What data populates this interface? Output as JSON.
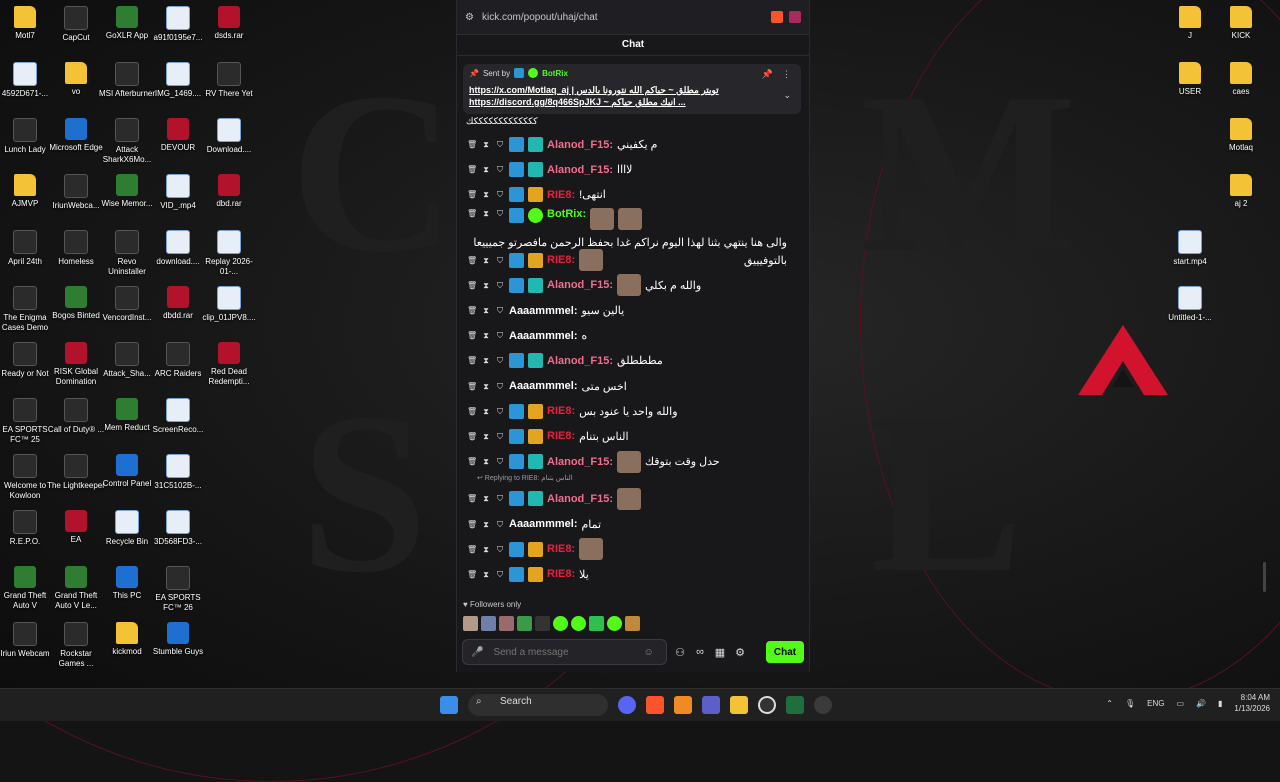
{
  "desktop": {
    "left_icons": [
      {
        "label": "Motl7",
        "kind": "folder"
      },
      {
        "label": "CapCut",
        "kind": "app"
      },
      {
        "label": "GoXLR App",
        "kind": "green"
      },
      {
        "label": "a91f0195e7...",
        "kind": "file"
      },
      {
        "label": "dsds.rar",
        "kind": "red"
      },
      {
        "label": "4592D671-...",
        "kind": "file"
      },
      {
        "label": "vo",
        "kind": "folder"
      },
      {
        "label": "MSI Afterburner",
        "kind": "app"
      },
      {
        "label": "IMG_1469....",
        "kind": "file"
      },
      {
        "label": "RV There Yet",
        "kind": "app"
      },
      {
        "label": "Lunch Lady",
        "kind": "app"
      },
      {
        "label": "Microsoft Edge",
        "kind": "blue"
      },
      {
        "label": "Attack SharkX6Mo...",
        "kind": "app"
      },
      {
        "label": "DEVOUR",
        "kind": "red"
      },
      {
        "label": "Download....",
        "kind": "file"
      },
      {
        "label": "AJMVP",
        "kind": "folder"
      },
      {
        "label": "IriunWebca...",
        "kind": "app"
      },
      {
        "label": "Wise Memor...",
        "kind": "green"
      },
      {
        "label": "VID_.mp4",
        "kind": "file"
      },
      {
        "label": "dbd.rar",
        "kind": "red"
      },
      {
        "label": "April 24th",
        "kind": "app"
      },
      {
        "label": "Homeless",
        "kind": "app"
      },
      {
        "label": "Revo Uninstaller",
        "kind": "app"
      },
      {
        "label": "download....",
        "kind": "file"
      },
      {
        "label": "Replay 2026-01-...",
        "kind": "file"
      },
      {
        "label": "The Enigma Cases Demo",
        "kind": "app"
      },
      {
        "label": "Bogos Binted",
        "kind": "green"
      },
      {
        "label": "VencordInst...",
        "kind": "app"
      },
      {
        "label": "dbdd.rar",
        "kind": "red"
      },
      {
        "label": "clip_01JPV8....",
        "kind": "file"
      },
      {
        "label": "Ready or Not",
        "kind": "app"
      },
      {
        "label": "RISK Global Domination",
        "kind": "red"
      },
      {
        "label": "Attack_Sha...",
        "kind": "app"
      },
      {
        "label": "ARC Raiders",
        "kind": "app"
      },
      {
        "label": "Red Dead Redempti...",
        "kind": "red"
      },
      {
        "label": "EA SPORTS FC™ 25",
        "kind": "app"
      },
      {
        "label": "Call of Duty® ...",
        "kind": "app"
      },
      {
        "label": "Mem Reduct",
        "kind": "green"
      },
      {
        "label": "ScreenReco...",
        "kind": "file"
      },
      {
        "label": "",
        "kind": "none"
      },
      {
        "label": "Welcome to Kowloon",
        "kind": "app"
      },
      {
        "label": "The Lightkeeper",
        "kind": "app"
      },
      {
        "label": "Control Panel",
        "kind": "blue"
      },
      {
        "label": "31C5102B-...",
        "kind": "file"
      },
      {
        "label": "",
        "kind": "none"
      },
      {
        "label": "R.E.P.O.",
        "kind": "app"
      },
      {
        "label": "EA",
        "kind": "red"
      },
      {
        "label": "Recycle Bin",
        "kind": "file"
      },
      {
        "label": "3D568FD3-...",
        "kind": "file"
      },
      {
        "label": "",
        "kind": "none"
      },
      {
        "label": "Grand Theft Auto V",
        "kind": "green"
      },
      {
        "label": "Grand Theft Auto V Le...",
        "kind": "green"
      },
      {
        "label": "This PC",
        "kind": "blue"
      },
      {
        "label": "EA SPORTS FC™ 26",
        "kind": "app"
      },
      {
        "label": "",
        "kind": "none"
      },
      {
        "label": "Iriun Webcam",
        "kind": "app"
      },
      {
        "label": "Rockstar Games ...",
        "kind": "app"
      },
      {
        "label": "kickmod",
        "kind": "folder"
      },
      {
        "label": "Stumble Guys",
        "kind": "blue"
      },
      {
        "label": "",
        "kind": "none"
      }
    ],
    "right_icons": [
      {
        "label": "J",
        "kind": "folder"
      },
      {
        "label": "KICK",
        "kind": "folder"
      },
      {
        "label": "USER",
        "kind": "folder"
      },
      {
        "label": "caes",
        "kind": "folder"
      },
      {
        "label": "",
        "kind": "none"
      },
      {
        "label": "Motlaq",
        "kind": "folder"
      },
      {
        "label": "",
        "kind": "none"
      },
      {
        "label": "aj 2",
        "kind": "folder"
      },
      {
        "label": "start.mp4",
        "kind": "file"
      },
      {
        "label": "",
        "kind": "none"
      },
      {
        "label": "Untitled-1-...",
        "kind": "file"
      },
      {
        "label": "",
        "kind": "none"
      }
    ]
  },
  "browser": {
    "url": "kick.com/popout/uhaj/chat",
    "chat_title": "Chat"
  },
  "pinned": {
    "sent_by_label": "Sent by",
    "bot_name": "BotRix",
    "line1": "https://x.com/Motlaq_aj | تويتر مطلق ~ حياكم الله نتورونا بالدس",
    "line2": "https://discord.gg/8q466SpJKJ ~ انيك مطلق حياكم ..."
  },
  "fragment_text": "كككككككككككككك",
  "messages": [
    {
      "user": "Alanod_F15",
      "color": "#f26d8e",
      "badges": [
        "blue",
        "teal"
      ],
      "text": "م يكفيني",
      "emotes": 0
    },
    {
      "user": "Alanod_F15",
      "color": "#f26d8e",
      "badges": [
        "blue",
        "teal"
      ],
      "text": "لاااا",
      "emotes": 0
    },
    {
      "user": "RIE8",
      "color": "#e8213f",
      "badges": [
        "blue",
        "crown"
      ],
      "text": "انتهى!",
      "emotes": 0
    },
    {
      "user": "BotRix",
      "color": "#53fc18",
      "badges": [
        "blue",
        "check"
      ],
      "text": "والى هنا ينتهي بثنا لهذا اليوم نراكم غدا بحفظ الرحمن مافصرتو جميييعا بالتوفيييق",
      "emotes": 2,
      "tall": true
    },
    {
      "user": "RIE8",
      "color": "#e8213f",
      "badges": [
        "blue",
        "crown"
      ],
      "text": "",
      "emotes": 1
    },
    {
      "user": "Alanod_F15",
      "color": "#f26d8e",
      "badges": [
        "blue",
        "teal"
      ],
      "text": "والله م بكلي",
      "emotes": 1
    },
    {
      "user": "Aaaammmel",
      "color": "#ffffff",
      "badges": [],
      "text": "يالين سيو",
      "emotes": 0
    },
    {
      "user": "Aaaammmel",
      "color": "#ffffff",
      "badges": [],
      "text": "ه",
      "emotes": 0
    },
    {
      "user": "Alanod_F15",
      "color": "#f26d8e",
      "badges": [
        "blue",
        "teal"
      ],
      "text": "مطططلق",
      "emotes": 0
    },
    {
      "user": "Aaaammmel",
      "color": "#ffffff",
      "badges": [],
      "text": "اخس متى",
      "emotes": 0
    },
    {
      "user": "RIE8",
      "color": "#e8213f",
      "badges": [
        "blue",
        "crown"
      ],
      "text": "والله واحد يا عنود بس",
      "emotes": 0
    },
    {
      "user": "RIE8",
      "color": "#e8213f",
      "badges": [
        "blue",
        "crown"
      ],
      "text": "الناس بتنام",
      "emotes": 0
    },
    {
      "user": "Alanod_F15",
      "color": "#f26d8e",
      "badges": [
        "blue",
        "teal"
      ],
      "text": "حدل وقت بتوقك",
      "emotes": 1
    },
    {
      "reply": "Replying to RIE8: الناس بتنام"
    },
    {
      "user": "Alanod_F15",
      "color": "#f26d8e",
      "badges": [
        "blue",
        "teal"
      ],
      "text": "",
      "emotes": 1
    },
    {
      "user": "Aaaammmel",
      "color": "#ffffff",
      "badges": [],
      "text": "تمام",
      "emotes": 0
    },
    {
      "user": "RIE8",
      "color": "#e8213f",
      "badges": [
        "blue",
        "crown"
      ],
      "text": "",
      "emotes": 1
    },
    {
      "user": "RIE8",
      "color": "#e8213f",
      "badges": [
        "blue",
        "crown"
      ],
      "text": "يلا",
      "emotes": 0
    }
  ],
  "footer": {
    "followers_only": "Followers only",
    "placeholder": "Send a message",
    "chat_button": "Chat"
  },
  "taskbar": {
    "search_label": "Search",
    "lang": "ENG",
    "time": "8:04 AM",
    "date": "1/13/2026"
  },
  "colors": {
    "kick_green": "#53fc18",
    "apex_red": "#d3122e"
  }
}
